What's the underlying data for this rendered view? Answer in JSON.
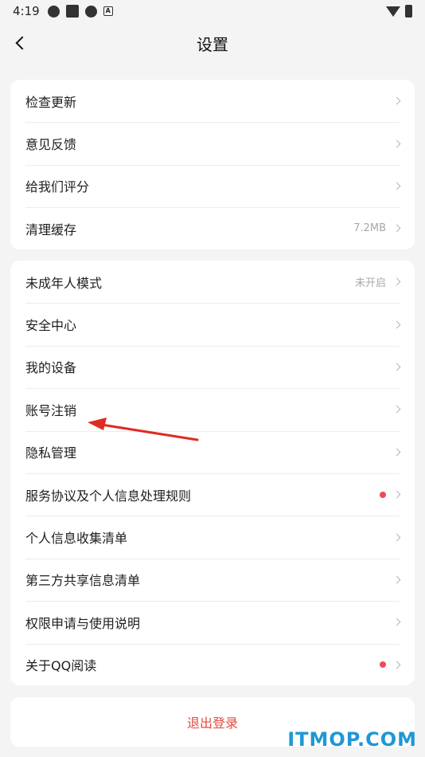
{
  "status_bar": {
    "time": "4:19"
  },
  "header": {
    "title": "设置"
  },
  "group1": [
    {
      "label": "检查更新",
      "value": ""
    },
    {
      "label": "意见反馈",
      "value": ""
    },
    {
      "label": "给我们评分",
      "value": ""
    },
    {
      "label": "清理缓存",
      "value": "7.2MB"
    }
  ],
  "group2": [
    {
      "label": "未成年人模式",
      "value": "未开启"
    },
    {
      "label": "安全中心",
      "value": ""
    },
    {
      "label": "我的设备",
      "value": ""
    },
    {
      "label": "账号注销",
      "value": ""
    },
    {
      "label": "隐私管理",
      "value": ""
    },
    {
      "label": "服务协议及个人信息处理规则",
      "value": ""
    },
    {
      "label": "个人信息收集清单",
      "value": ""
    },
    {
      "label": "第三方共享信息清单",
      "value": ""
    },
    {
      "label": "权限申请与使用说明",
      "value": ""
    },
    {
      "label": "关于QQ阅读",
      "value": ""
    }
  ],
  "logout": {
    "label": "退出登录"
  },
  "watermark": "ITMOP.COM",
  "colors": {
    "accent_red": "#e6493f",
    "badge_red": "#ee4a57",
    "watermark_blue": "#1f97d6",
    "background": "#f4f4f4"
  }
}
